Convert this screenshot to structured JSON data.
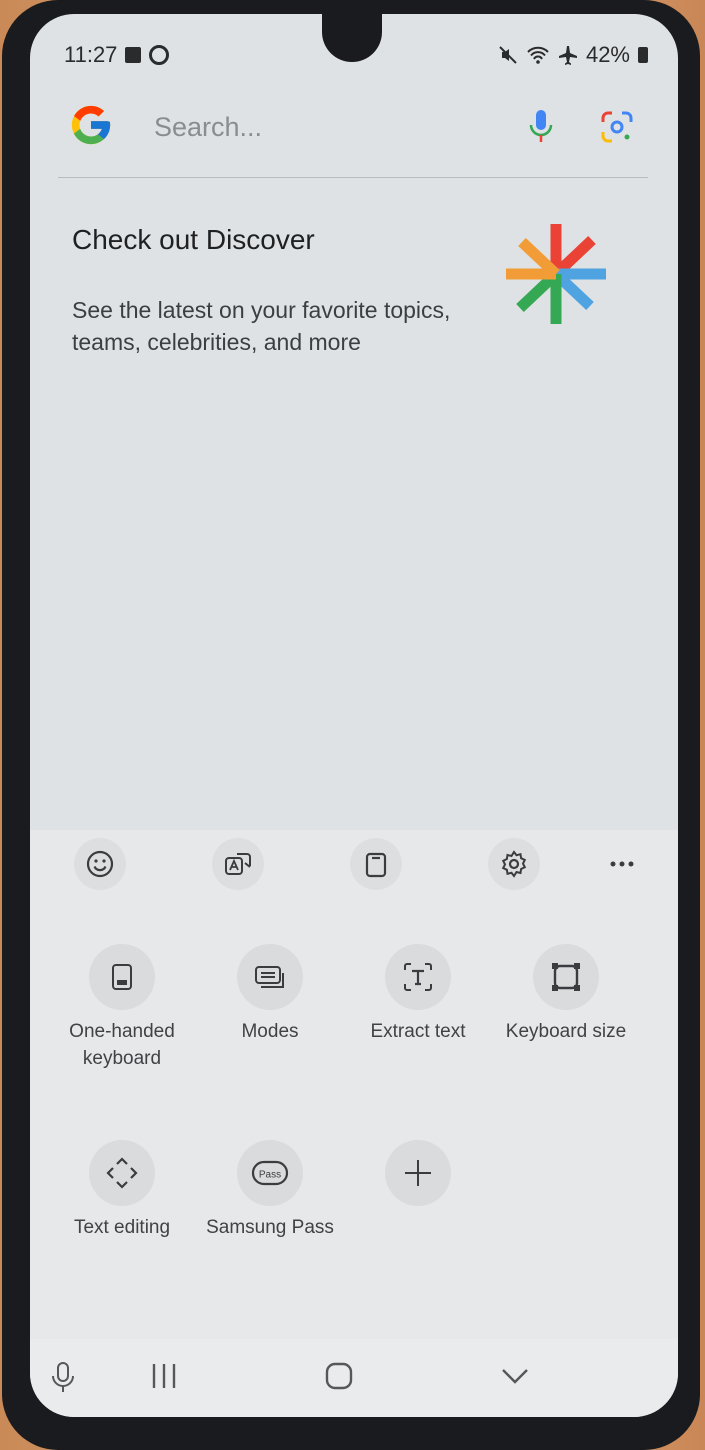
{
  "status_bar": {
    "time": "11:27",
    "battery": "42%"
  },
  "search": {
    "placeholder": "Search..."
  },
  "discover": {
    "title": "Check out Discover",
    "body": "See the latest on your favorite topics, teams, celebrities, and more"
  },
  "keyboard_toolbar": {
    "icons": [
      "emoji-icon",
      "translate-icon",
      "clipboard-icon",
      "settings-gear-icon",
      "more-options-icon"
    ]
  },
  "keyboard_tools": [
    {
      "label": "One-handed keyboard",
      "icon": "one-handed-keyboard-icon"
    },
    {
      "label": "Modes",
      "icon": "modes-icon"
    },
    {
      "label": "Extract text",
      "icon": "extract-text-icon"
    },
    {
      "label": "Keyboard size",
      "icon": "keyboard-size-icon"
    },
    {
      "label": "Text editing",
      "icon": "text-editing-icon"
    },
    {
      "label": "Samsung Pass",
      "icon": "samsung-pass-icon"
    },
    {
      "label": "",
      "icon": "add-icon"
    }
  ],
  "pass_badge": "Pass",
  "nav_bar": {
    "icons": [
      "voice-input-icon",
      "recent-apps-icon",
      "home-icon",
      "hide-keyboard-icon"
    ]
  },
  "colors": {
    "screen_bg": "#dfe2e4",
    "panel_bg": "#e6e8ea",
    "text": "#404346"
  }
}
